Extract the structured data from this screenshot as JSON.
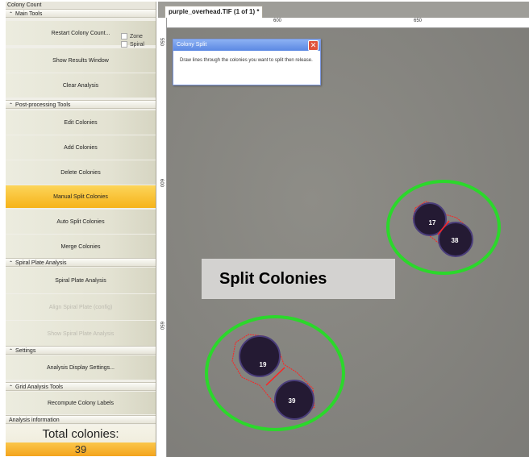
{
  "sidebar": {
    "app_title": "Colony Count",
    "sections": {
      "main_tools": "Main Tools",
      "post_processing": "Post-processing Tools",
      "spiral": "Spiral Plate Analysis",
      "settings": "Settings",
      "grid": "Grid Analysis Tools",
      "analysis_info": "Analysis information"
    },
    "buttons": {
      "restart": "Restart Colony Count...",
      "show_results": "Show Results Window",
      "clear": "Clear Analysis",
      "edit": "Edit Colonies",
      "add": "Add Colonies",
      "delete": "Delete Colonies",
      "manual_split": "Manual Split Colonies",
      "auto_split": "Auto Split Colonies",
      "merge": "Merge Colonies",
      "spiral_analysis": "Spiral Plate Analysis",
      "align_spiral": "Align Spiral Plate (config)",
      "show_spiral": "Show Spiral Plate Analysis",
      "display_settings": "Analysis Display Settings...",
      "recompute": "Recompute Colony Labels"
    },
    "checkboxes": {
      "zone": "Zone",
      "spiral": "Spiral"
    },
    "total_label": "Total colonies:",
    "total_value": "39"
  },
  "document": {
    "tab_title": "purple_overhead.TIF (1 of 1) *",
    "ruler_corner": "Px",
    "ruler_top": [
      "600",
      "650"
    ],
    "ruler_left": [
      "550",
      "600",
      "650"
    ]
  },
  "popup": {
    "title": "Colony Split",
    "message": "Draw lines through the colonies you want to split then release."
  },
  "annotation": "Split Colonies",
  "colonies": {
    "a": "17",
    "b": "38",
    "c": "19",
    "d": "39"
  },
  "colors": {
    "highlight_ring": "#2bd82b",
    "split_line": "#ff2222",
    "active_button": "#f6b31a",
    "colony": "#241a33"
  }
}
